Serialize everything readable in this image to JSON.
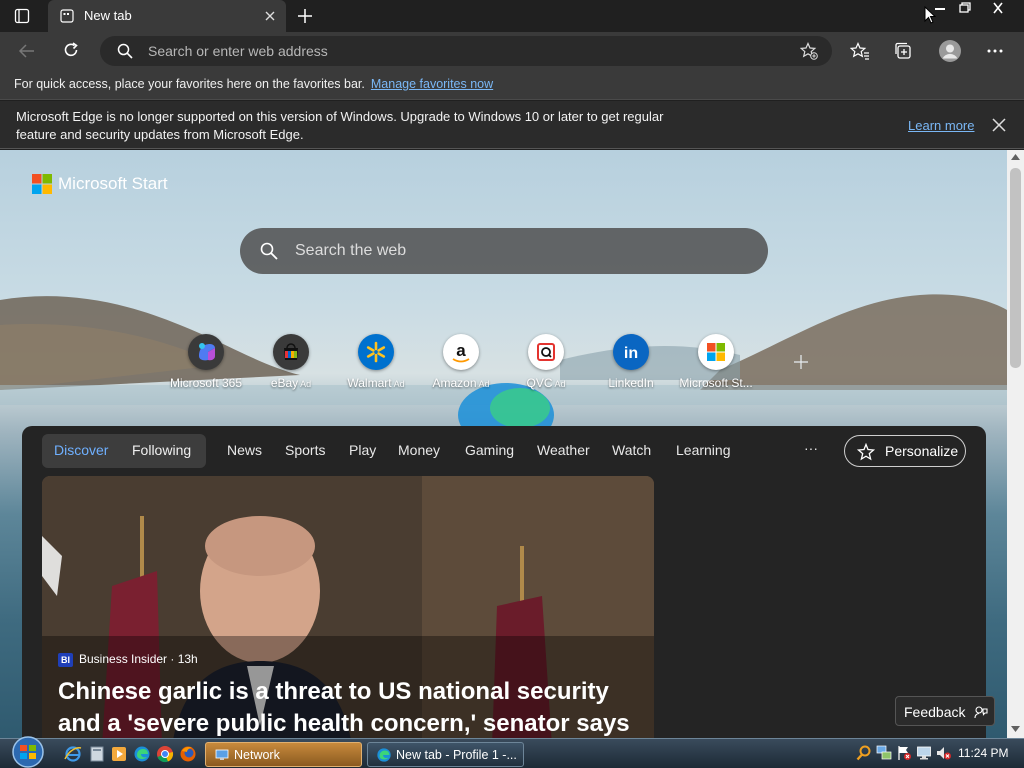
{
  "browser": {
    "tab_title": "New tab",
    "address_placeholder": "Search or enter web address"
  },
  "favorites_bar": {
    "text": "For quick access, place your favorites here on the favorites bar.",
    "link": "Manage favorites now"
  },
  "infobar": {
    "message": "Microsoft Edge is no longer supported on this version of Windows. Upgrade to Windows 10 or later to get regular feature and security updates from Microsoft Edge.",
    "learn_more": "Learn more"
  },
  "start": {
    "brand": "Microsoft Start",
    "search_placeholder": "Search the web"
  },
  "quick_links": [
    {
      "label": "Microsoft 365",
      "ad": "",
      "icon": "microsoft-365-icon"
    },
    {
      "label": "eBay",
      "ad": "Ad",
      "icon": "ebay-icon"
    },
    {
      "label": "Walmart",
      "ad": "Ad",
      "icon": "walmart-icon"
    },
    {
      "label": "Amazon",
      "ad": "Ad",
      "icon": "amazon-icon"
    },
    {
      "label": "QVC",
      "ad": "Ad",
      "icon": "qvc-icon"
    },
    {
      "label": "LinkedIn",
      "ad": "",
      "icon": "linkedin-icon"
    },
    {
      "label": "Microsoft St...",
      "ad": "",
      "icon": "microsoft-store-icon"
    }
  ],
  "feed": {
    "segments": [
      "Discover",
      "Following"
    ],
    "nav": [
      "News",
      "Sports",
      "Play",
      "Money",
      "Gaming",
      "Weather",
      "Watch",
      "Learning"
    ],
    "more": "···",
    "personalize": "Personalize",
    "hero": {
      "source_badge": "BI",
      "source": "Business Insider · 13h",
      "title": "Chinese garlic is a threat to US national security and a 'severe public health concern,' senator says"
    },
    "feedback": "Feedback"
  },
  "taskbar": {
    "tasks": [
      "Network",
      "New tab - Profile 1 -..."
    ],
    "clock": "11:24 PM"
  },
  "colors": {
    "accent_link": "#7ab7f5",
    "discover_active": "#6fb0ff",
    "chrome_bg": "#3a3a3a"
  }
}
